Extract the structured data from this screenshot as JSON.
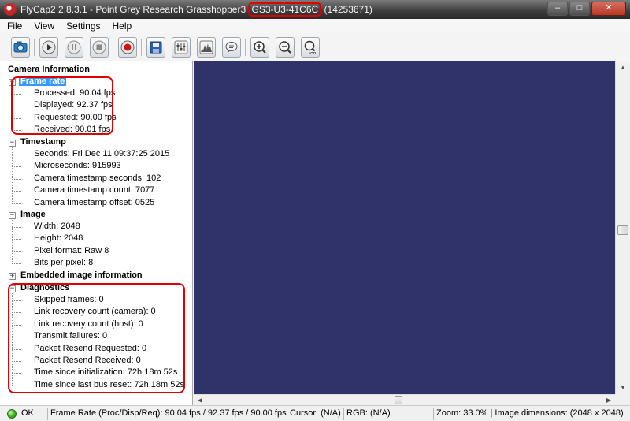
{
  "window": {
    "title_prefix": "FlyCap2 2.8.3.1 - Point Grey Research Grasshopper3 ",
    "title_serial": "GS3-U3-41C6C",
    "title_suffix": " (14253671)",
    "minimize_glyph": "–",
    "maximize_glyph": "□",
    "close_glyph": "✕"
  },
  "menu": {
    "items": [
      "File",
      "View",
      "Settings",
      "Help"
    ]
  },
  "toolbar": {
    "buttons": [
      "camera-select-icon",
      "start-icon",
      "pause-icon",
      "stop-icon",
      "record-icon",
      "save-icon",
      "settings-sliders-icon",
      "histogram-icon",
      "event-stats-icon",
      "zoom-in-icon",
      "zoom-out-icon",
      "zoom-100-icon"
    ]
  },
  "panel": {
    "heading": "Camera Information",
    "frame_rate": {
      "title": "Frame rate",
      "items": [
        "Processed: 90.04 fps",
        "Displayed: 92.37 fps",
        "Requested: 90.00 fps",
        "Received: 90.01 fps"
      ]
    },
    "timestamp": {
      "title": "Timestamp",
      "items": [
        "Seconds: Fri Dec 11 09:37:25 2015",
        "Microseconds: 915993",
        "Camera timestamp seconds: 102",
        "Camera timestamp count:  7077",
        "Camera timestamp offset: 0525"
      ]
    },
    "image": {
      "title": "Image",
      "items": [
        "Width: 2048",
        "Height: 2048",
        "Pixel format: Raw 8",
        "Bits per pixel:  8"
      ]
    },
    "embedded": {
      "title": "Embedded image information"
    },
    "diagnostics": {
      "title": "Diagnostics",
      "items": [
        "Skipped frames: 0",
        "Link recovery count (camera): 0",
        "Link recovery count (host): 0",
        "Transmit failures: 0",
        "Packet Resend Requested: 0",
        "Packet Resend Received: 0",
        "Time since initialization: 72h 18m 52s",
        "Time since last bus reset: 72h 18m 52s"
      ]
    }
  },
  "colors": {
    "image_background": "#30336a",
    "highlight_box": "#e10000",
    "selection": "#3399ff"
  },
  "status": {
    "state": "OK",
    "frame_rate": "Frame Rate (Proc/Disp/Req): 90.04 fps / 92.37 fps / 90.00 fps",
    "cursor": "Cursor: (N/A)",
    "rgb": "RGB: (N/A)",
    "zoom_info": "Zoom: 33.0% | Image dimensions: (2048 x 2048)"
  }
}
